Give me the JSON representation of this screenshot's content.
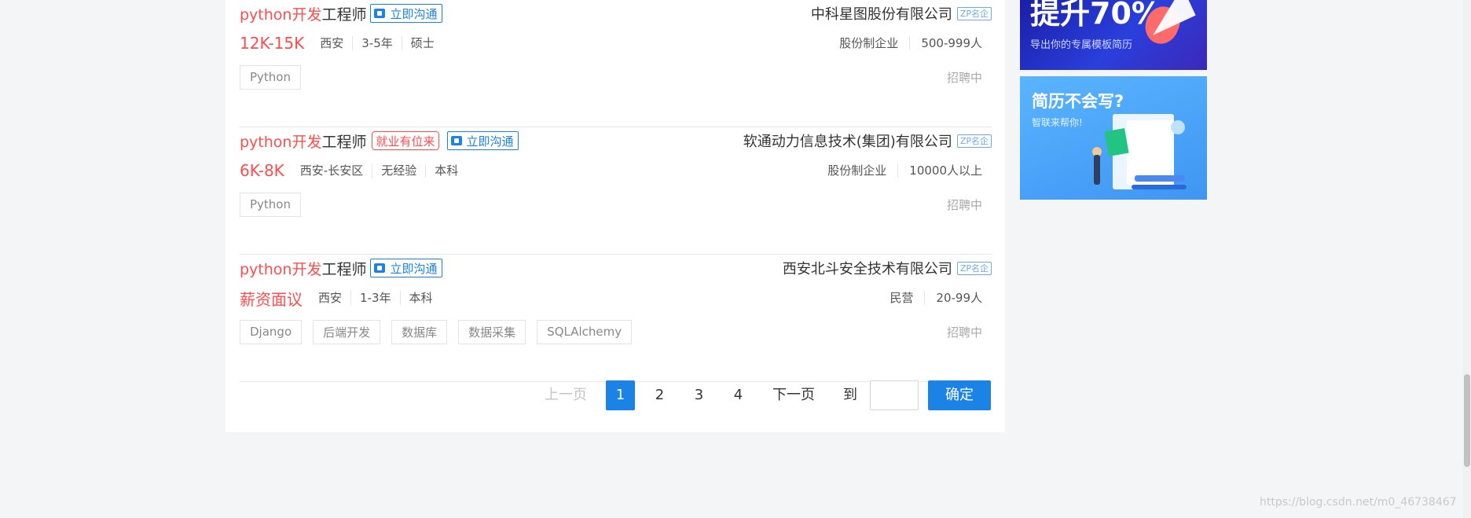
{
  "jobs": [
    {
      "title_highlight": "python开发",
      "title_rest": "工程师",
      "chat_label": "立即沟通",
      "special_tag": "",
      "company": "中科星图股份有限公司",
      "company_badge": "ZP名企",
      "salary": "12K-15K",
      "location": "西安",
      "experience": "3-5年",
      "education": "硕士",
      "company_type": "股份制企业",
      "company_size": "500-999人",
      "skills": [
        "Python"
      ],
      "status": "招聘中"
    },
    {
      "title_highlight": "python开发",
      "title_rest": "工程师",
      "chat_label": "立即沟通",
      "special_tag": "就业有位来",
      "company": "软通动力信息技术(集团)有限公司",
      "company_badge": "ZP名企",
      "salary": "6K-8K",
      "location": "西安-长安区",
      "experience": "无经验",
      "education": "本科",
      "company_type": "股份制企业",
      "company_size": "10000人以上",
      "skills": [
        "Python"
      ],
      "status": "招聘中"
    },
    {
      "title_highlight": "python开发",
      "title_rest": "工程师",
      "chat_label": "立即沟通",
      "special_tag": "",
      "company": "西安北斗安全技术有限公司",
      "company_badge": "ZP名企",
      "salary": "薪资面议",
      "location": "西安",
      "experience": "1-3年",
      "education": "本科",
      "company_type": "民营",
      "company_size": "20-99人",
      "skills": [
        "Django",
        "后端开发",
        "数据库",
        "数据采集",
        "SQLAlchemy"
      ],
      "status": "招聘中"
    }
  ],
  "pagination": {
    "prev": "上一页",
    "pages": [
      "1",
      "2",
      "3",
      "4"
    ],
    "current_page": "1",
    "next": "下一页",
    "goto_label": "到",
    "goto_value": "",
    "confirm": "确定"
  },
  "banners": {
    "banner1_title": "提升70%",
    "banner1_sub": "导出你的专属模板简历",
    "banner2_title": "简历不会写?",
    "banner2_sub": "智联来帮你!"
  },
  "watermark": "https://blog.csdn.net/m0_46738467",
  "colors": {
    "accent": "#1b82e6",
    "highlight": "#ff4d4f",
    "background": "#f4f5f7"
  }
}
